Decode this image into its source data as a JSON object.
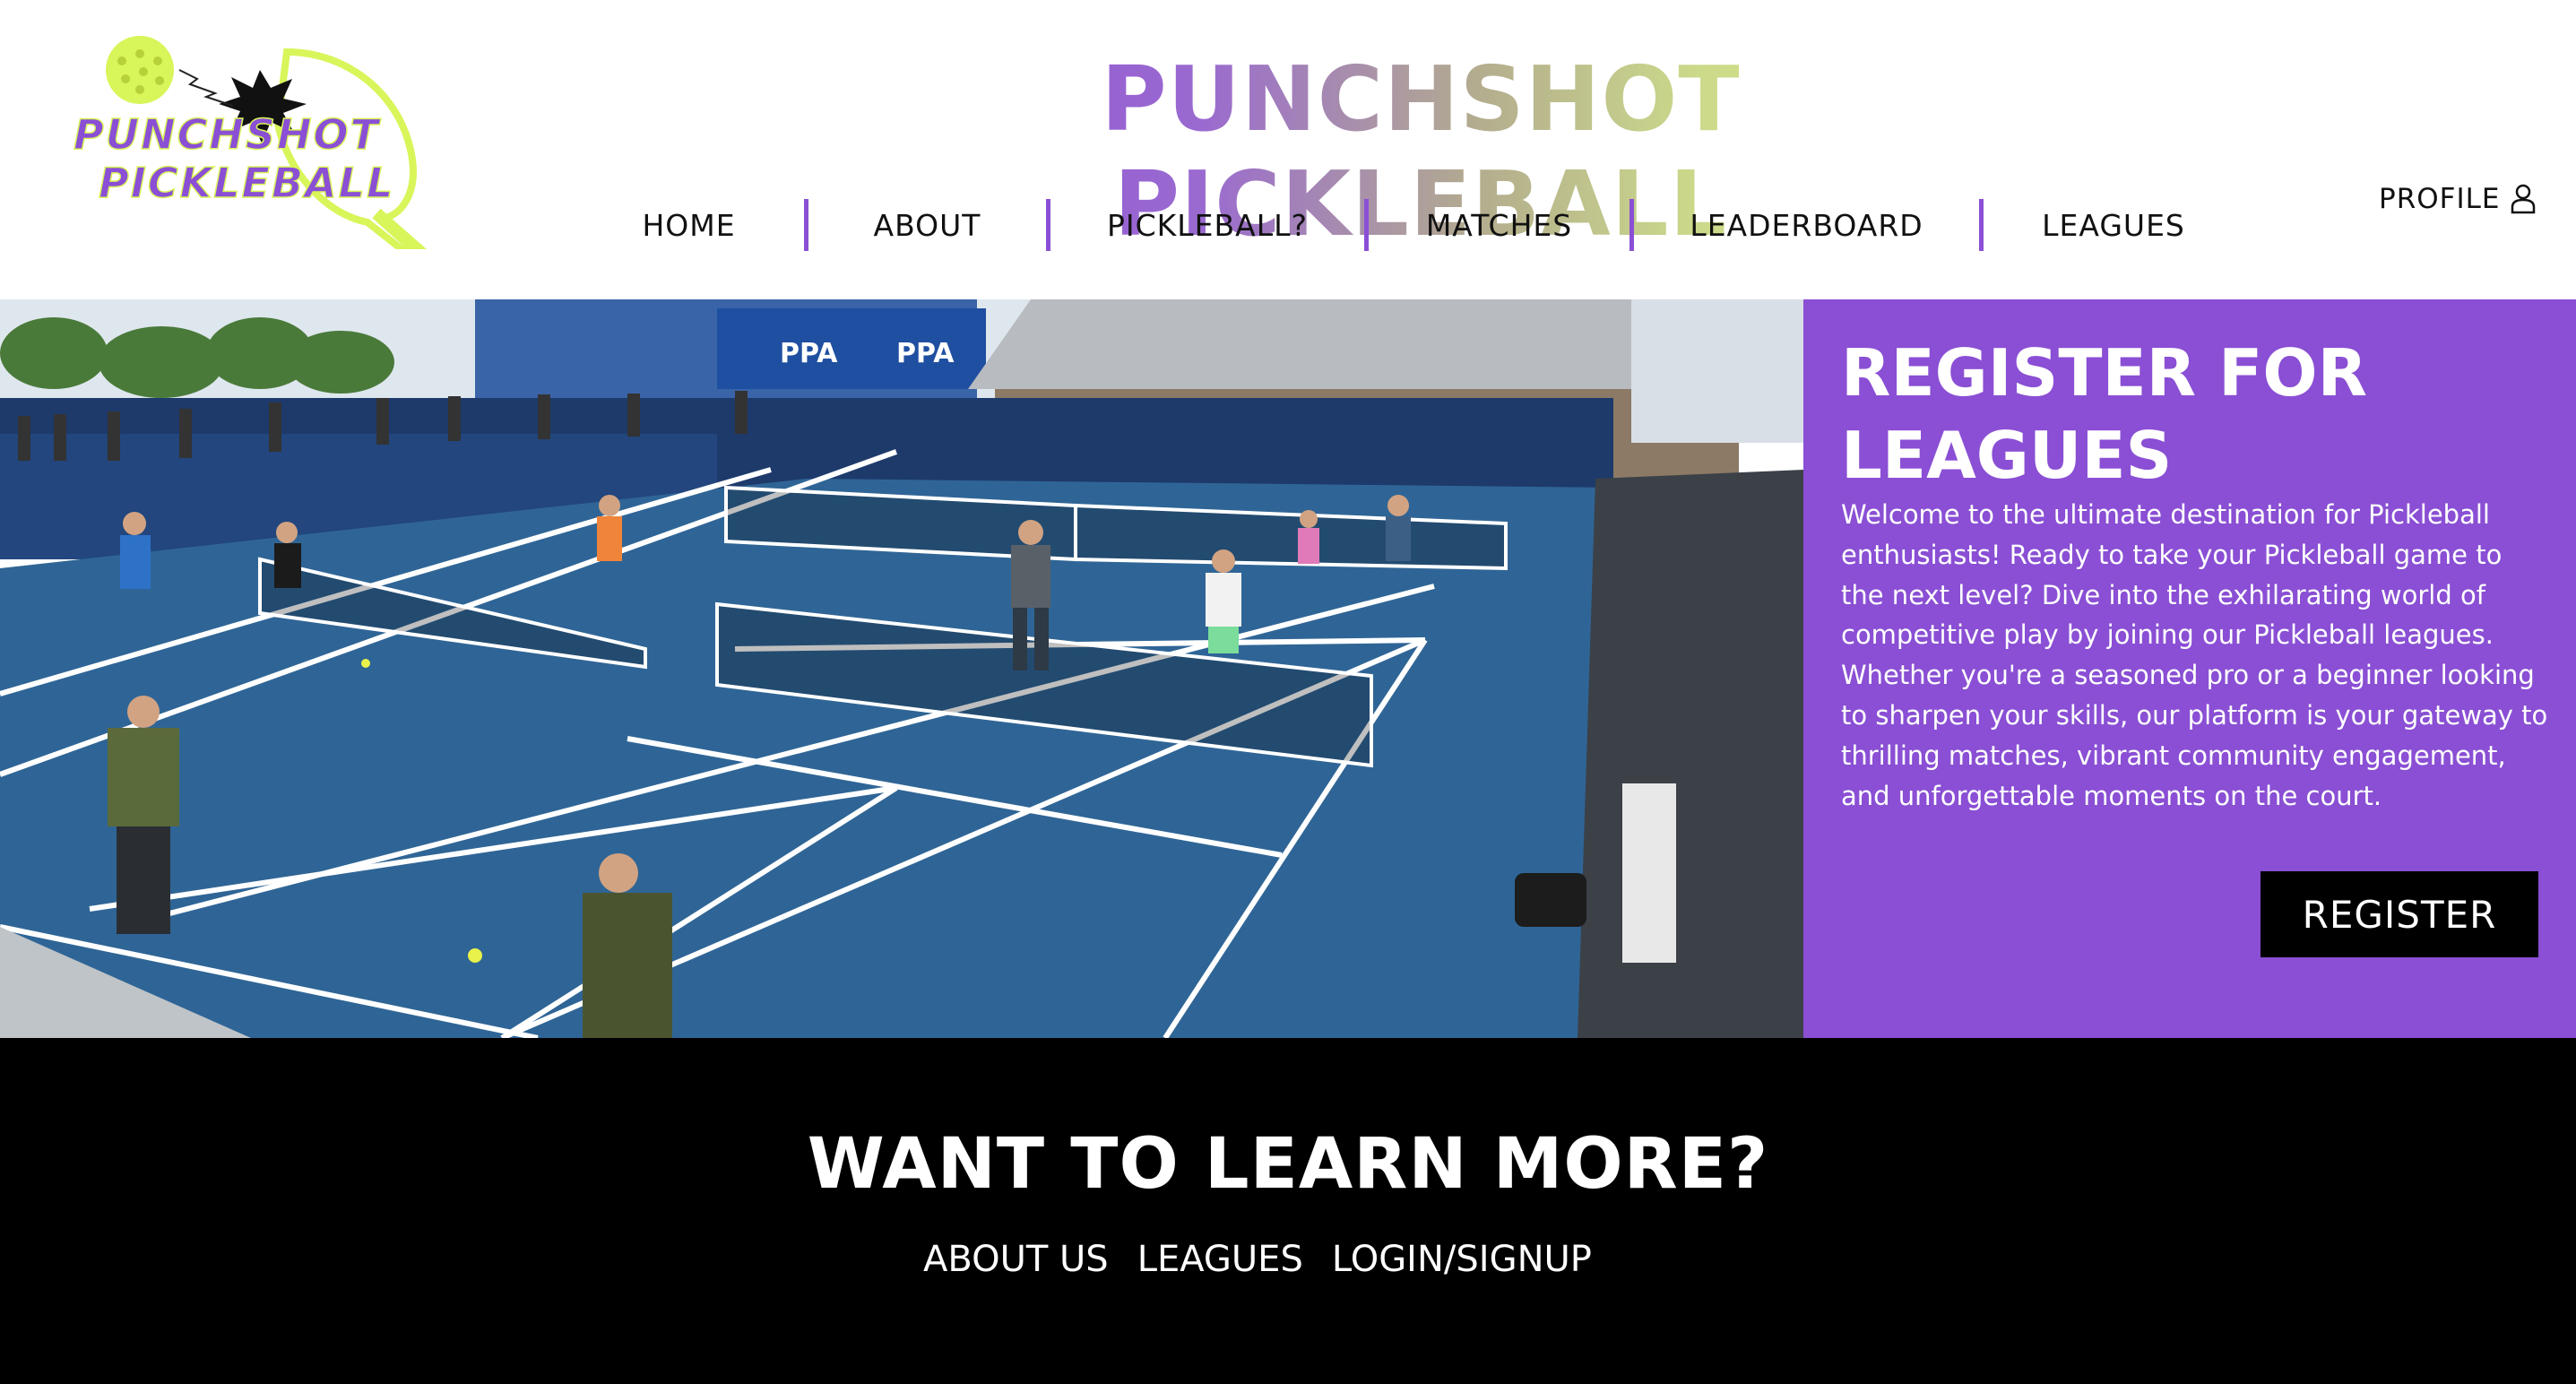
{
  "header": {
    "logo_alt": "PUNCHSHOT PICKLEBALL",
    "site_title": "PUNCHSHOT PICKLEBALL",
    "nav": [
      {
        "label": "HOME"
      },
      {
        "label": "ABOUT"
      },
      {
        "label": "PICKLEBALL?"
      },
      {
        "label": "MATCHES"
      },
      {
        "label": "LEADERBOARD"
      },
      {
        "label": "LEAGUES"
      }
    ],
    "profile_label": "PROFILE",
    "profile_icon": "user-icon"
  },
  "hero": {
    "register_title": "REGISTER FOR LEAGUES",
    "register_text": "Welcome to the ultimate destination for Pickleball enthusiasts! Ready to take your Pickleball game to the next level? Dive into the exhilarating world of competitive play by joining our Pickleball leagues. Whether you're a seasoned pro or a beginner looking to sharpen your skills, our platform is your gateway to thrilling matches, vibrant community engagement, and unforgettable moments on the court.",
    "register_button": "REGISTER",
    "banner_text": "PPA"
  },
  "learn_more": {
    "title": "WANT TO LEARN MORE?",
    "links": [
      {
        "label": "ABOUT US"
      },
      {
        "label": "LEAGUES"
      },
      {
        "label": "LOGIN/SIGNUP"
      }
    ]
  },
  "colors": {
    "accent_purple": "#8a4fd4",
    "lime": "#d8f55a",
    "black": "#000000",
    "court_blue": "#2f6596"
  }
}
